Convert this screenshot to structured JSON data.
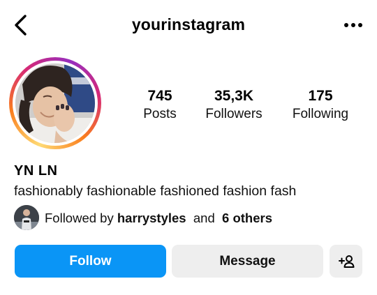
{
  "header": {
    "username": "yourinstagram",
    "back_icon": "chevron-left-icon",
    "more_icon": "more-horizontal-icon"
  },
  "profile": {
    "avatar_ring_colors": [
      "#feda75",
      "#fa7e1e",
      "#d62976",
      "#962fbf"
    ],
    "name": "YN LN",
    "bio": "fashionably fashionable fashioned fashion fash"
  },
  "stats": [
    {
      "value": "745",
      "label": "Posts"
    },
    {
      "value": "35,3K",
      "label": "Followers"
    },
    {
      "value": "175",
      "label": "Following"
    }
  ],
  "followed_by": {
    "prefix": "Followed by",
    "user": "harrystyles",
    "joiner": "and",
    "others": "6 others"
  },
  "actions": {
    "follow_label": "Follow",
    "message_label": "Message",
    "suggest_icon": "add-person-icon",
    "follow_color": "#0a95f6",
    "secondary_color": "#eeeeee"
  }
}
